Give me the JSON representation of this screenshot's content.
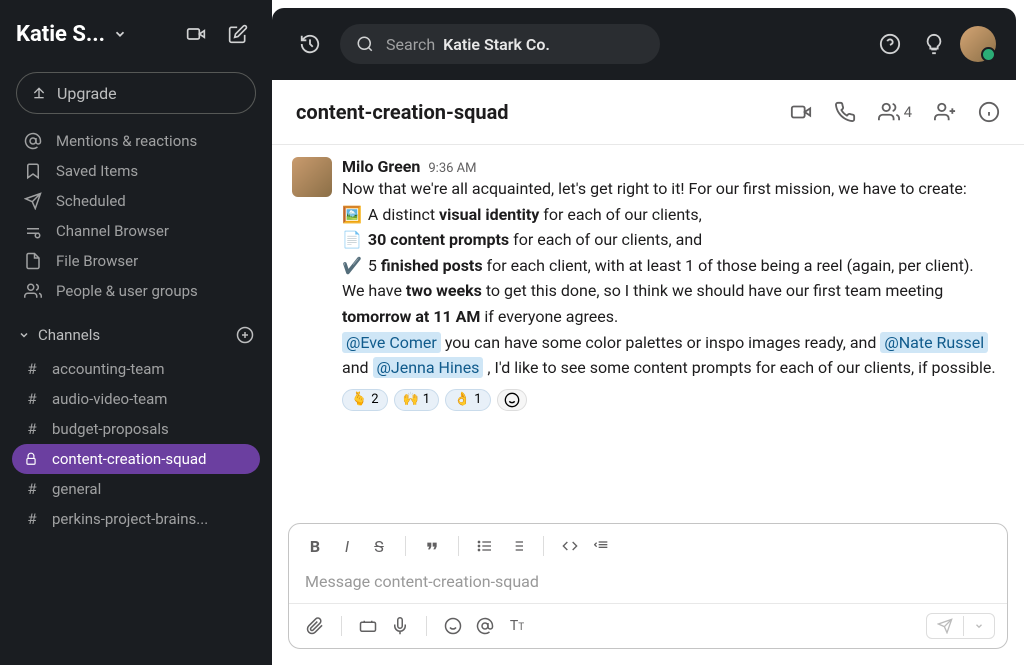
{
  "workspace": {
    "name": "Katie S..."
  },
  "search": {
    "label": "Search",
    "bold": "Katie Stark Co."
  },
  "upgrade": {
    "label": "Upgrade"
  },
  "nav": {
    "items": [
      {
        "icon": "at",
        "label": "Mentions & reactions"
      },
      {
        "icon": "bookmark",
        "label": "Saved Items"
      },
      {
        "icon": "send",
        "label": "Scheduled"
      },
      {
        "icon": "channels",
        "label": "Channel Browser"
      },
      {
        "icon": "file",
        "label": "File Browser"
      },
      {
        "icon": "people",
        "label": "People & user groups"
      }
    ]
  },
  "channels": {
    "header": "Channels",
    "list": [
      {
        "name": "accounting-team",
        "icon": "hash",
        "active": false
      },
      {
        "name": "audio-video-team",
        "icon": "hash",
        "active": false
      },
      {
        "name": "budget-proposals",
        "icon": "hash",
        "active": false
      },
      {
        "name": "content-creation-squad",
        "icon": "lock",
        "active": true
      },
      {
        "name": "general",
        "icon": "hash",
        "active": false
      },
      {
        "name": "perkins-project-brains...",
        "icon": "hash",
        "active": false
      }
    ]
  },
  "channelHeader": {
    "title": "content-creation-squad",
    "memberCount": "4"
  },
  "message": {
    "author": "Milo Green",
    "time": "9:36 AM",
    "intro": "Now that we're all acquainted, let's get right to it! For our first mission, we have to create:",
    "bullets": [
      {
        "emoji": "🖼️",
        "pre": "A distinct ",
        "bold": "visual identity",
        "post": " for each of our clients,"
      },
      {
        "emoji": "📄",
        "pre": "",
        "bold": "30 content prompts",
        "post": " for each of our clients, and"
      },
      {
        "emoji": "✔️",
        "pre": "5 ",
        "bold": "finished posts",
        "post": " for each client, with at least 1 of those being a reel (again, per client)."
      }
    ],
    "para2_pre": "We have ",
    "para2_bold1": "two weeks",
    "para2_mid": " to get this done, so I think we should have our first team meeting ",
    "para2_bold2": "tomorrow at 11 AM",
    "para2_post": " if everyone agrees.",
    "mention1": "@Eve Comer",
    "m1_post": " you can have some color palettes or inspo images ready, and ",
    "mention2": "@Nate Russel",
    "m2_post": " and ",
    "mention3": "@Jenna Hines",
    "m3_post": " , I'd like to see some content prompts for each of our clients, if possible.",
    "reactions": [
      {
        "emoji": "🫰",
        "count": "2"
      },
      {
        "emoji": "🙌",
        "count": "1"
      },
      {
        "emoji": "👌",
        "count": "1"
      }
    ]
  },
  "composer": {
    "placeholder": "Message content-creation-squad"
  }
}
